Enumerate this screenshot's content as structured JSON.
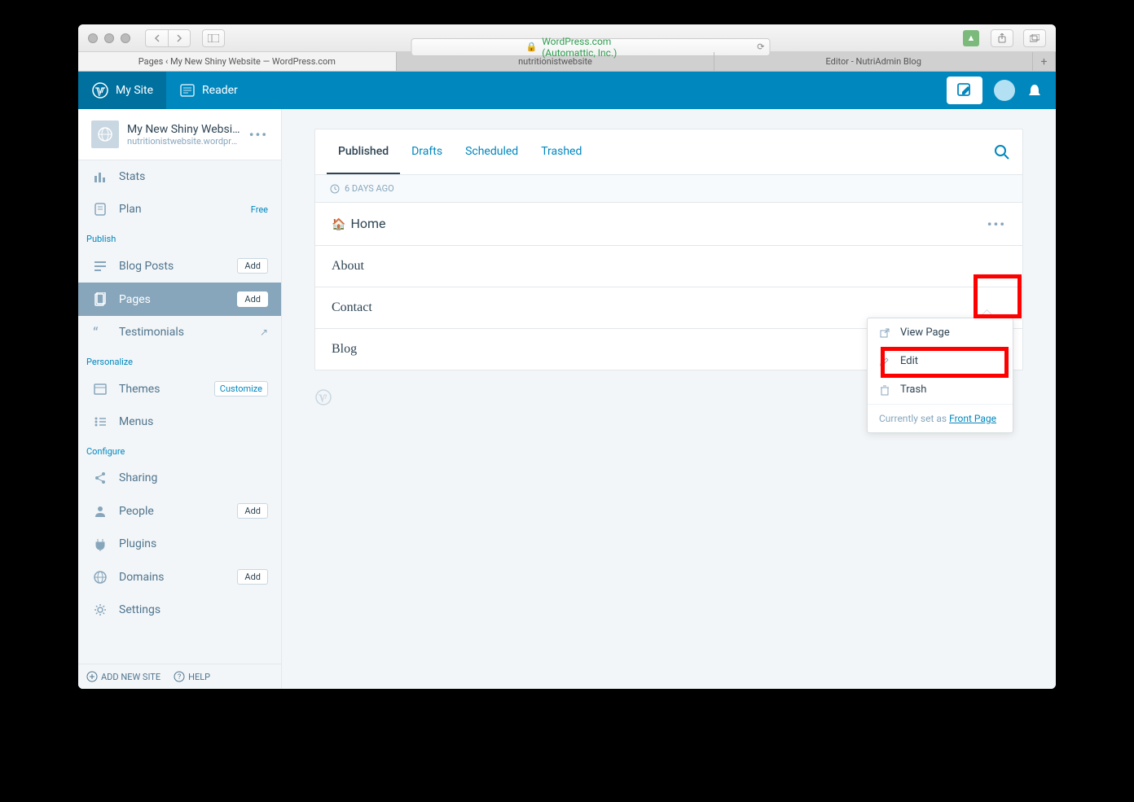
{
  "browser": {
    "url": "WordPress.com (Automattic, Inc.)",
    "tabs": [
      "Pages ‹ My New Shiny Website — WordPress.com",
      "nutritionistwebsite",
      "Editor - NutriAdmin Blog"
    ]
  },
  "masterbar": {
    "my_site": "My Site",
    "reader": "Reader"
  },
  "site": {
    "title": "My New Shiny Website",
    "url": "nutritionistwebsite.wordpress.c"
  },
  "sidebar": {
    "stats": "Stats",
    "plan": "Plan",
    "plan_badge": "Free",
    "publish_heading": "Publish",
    "blog_posts": "Blog Posts",
    "pages": "Pages",
    "testimonials": "Testimonials",
    "personalize_heading": "Personalize",
    "themes": "Themes",
    "customize": "Customize",
    "menus": "Menus",
    "configure_heading": "Configure",
    "sharing": "Sharing",
    "people": "People",
    "plugins": "Plugins",
    "domains": "Domains",
    "settings": "Settings",
    "add": "Add",
    "add_new_site": "ADD NEW SITE",
    "help": "HELP"
  },
  "page_tabs": {
    "published": "Published",
    "drafts": "Drafts",
    "scheduled": "Scheduled",
    "trashed": "Trashed"
  },
  "time_header": "6 DAYS AGO",
  "pages": [
    {
      "title": "Home",
      "has_home_icon": true,
      "has_menu": true
    },
    {
      "title": "About"
    },
    {
      "title": "Contact"
    },
    {
      "title": "Blog"
    }
  ],
  "popover": {
    "view": "View Page",
    "edit": "Edit",
    "trash": "Trash",
    "footer_prefix": "Currently set as ",
    "footer_link": "Front Page"
  }
}
